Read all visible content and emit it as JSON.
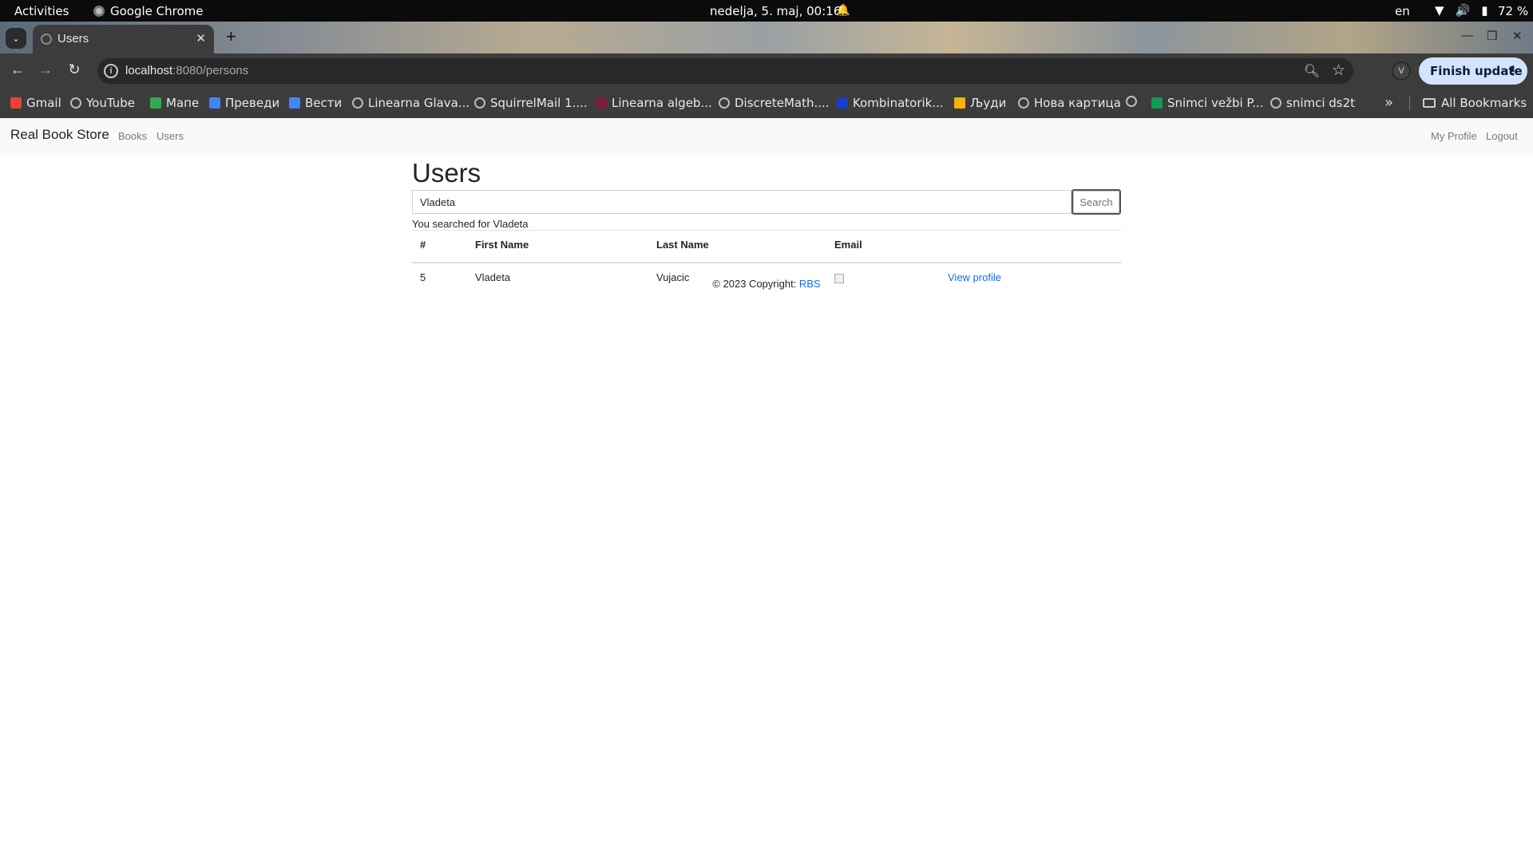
{
  "system_bar": {
    "activities": "Activities",
    "app_name": "Google Chrome",
    "clock": "nedelja,  5. maj, 00:16",
    "language": "en",
    "battery": "72 %"
  },
  "browser": {
    "tab_title": "Users",
    "url_host": "localhost",
    "url_path": ":8080/persons",
    "profile_initial": "V",
    "update_button": "Finish update",
    "bookmarks": [
      {
        "label": "Gmail",
        "icon": "gmail-icon",
        "color": "#ea4335"
      },
      {
        "label": "YouTube",
        "icon": "globe-icon",
        "color": "#bbbbbb"
      },
      {
        "label": "Мапе",
        "icon": "maps-icon",
        "color": "#34a853"
      },
      {
        "label": "Преведи",
        "icon": "translate-icon",
        "color": "#4285f4"
      },
      {
        "label": "Вести",
        "icon": "news-icon",
        "color": "#4285f4"
      },
      {
        "label": "Linearna Glava...",
        "icon": "globe-icon",
        "color": "#bbbbbb"
      },
      {
        "label": "SquirrelMail 1....",
        "icon": "globe-icon",
        "color": "#bbbbbb"
      },
      {
        "label": "Linearna algeb...",
        "icon": "matf-icon",
        "color": "#7b1f3a"
      },
      {
        "label": "DiscreteMath....",
        "icon": "globe-icon",
        "color": "#bbbbbb"
      },
      {
        "label": "Kombinatorik...",
        "icon": "m-icon",
        "color": "#1a3ccf"
      },
      {
        "label": "Људи",
        "icon": "people-icon",
        "color": "#f4b400"
      },
      {
        "label": "Нова картица",
        "icon": "globe-icon",
        "color": "#bbbbbb"
      },
      {
        "label": "",
        "icon": "globe-icon",
        "color": "#bbbbbb"
      },
      {
        "label": "Snimci vežbi P...",
        "icon": "sheets-icon",
        "color": "#0f9d58"
      },
      {
        "label": "snimci ds2t",
        "icon": "globe-icon",
        "color": "#bbbbbb"
      }
    ],
    "all_bookmarks": "All Bookmarks"
  },
  "site": {
    "brand": "Real Book Store",
    "nav": [
      "Books",
      "Users"
    ],
    "nav_right": [
      "My Profile",
      "Logout"
    ],
    "page_title": "Users",
    "search": {
      "value": "Vladeta",
      "button": "Search"
    },
    "searched_text": "You searched for Vladeta",
    "table": {
      "headers": [
        "#",
        "First Name",
        "Last Name",
        "Email"
      ],
      "rows": [
        {
          "id": "5",
          "first_name": "Vladeta",
          "last_name": "Vujacic",
          "action": "View profile"
        }
      ]
    },
    "footer": {
      "text": "© 2023 Copyright: ",
      "link": "RBS"
    }
  }
}
